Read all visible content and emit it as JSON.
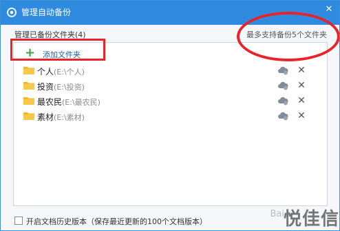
{
  "window": {
    "title": "管理自动备份",
    "close_icon": "close-icon",
    "accent": "#2f8be0"
  },
  "backup": {
    "section_label": "管理已备份文件夹(4)",
    "support_text": "最多支持备份5个文件夹",
    "add_label": "添加文件夹",
    "folders": [
      {
        "name": "个人",
        "path": "(E:\\个人)"
      },
      {
        "name": "投资",
        "path": "(E:\\投资)"
      },
      {
        "name": "最农民",
        "path": "(E:\\最农民)"
      },
      {
        "name": "素材",
        "path": "(E:\\素材)"
      }
    ]
  },
  "footer": {
    "history_label": "开启文档历史版本（保存最近更新的100个文档版本）",
    "checked": false
  },
  "watermark": {
    "text": "悦佳信",
    "small": "Bai"
  },
  "annotation_color": "#e8232a"
}
